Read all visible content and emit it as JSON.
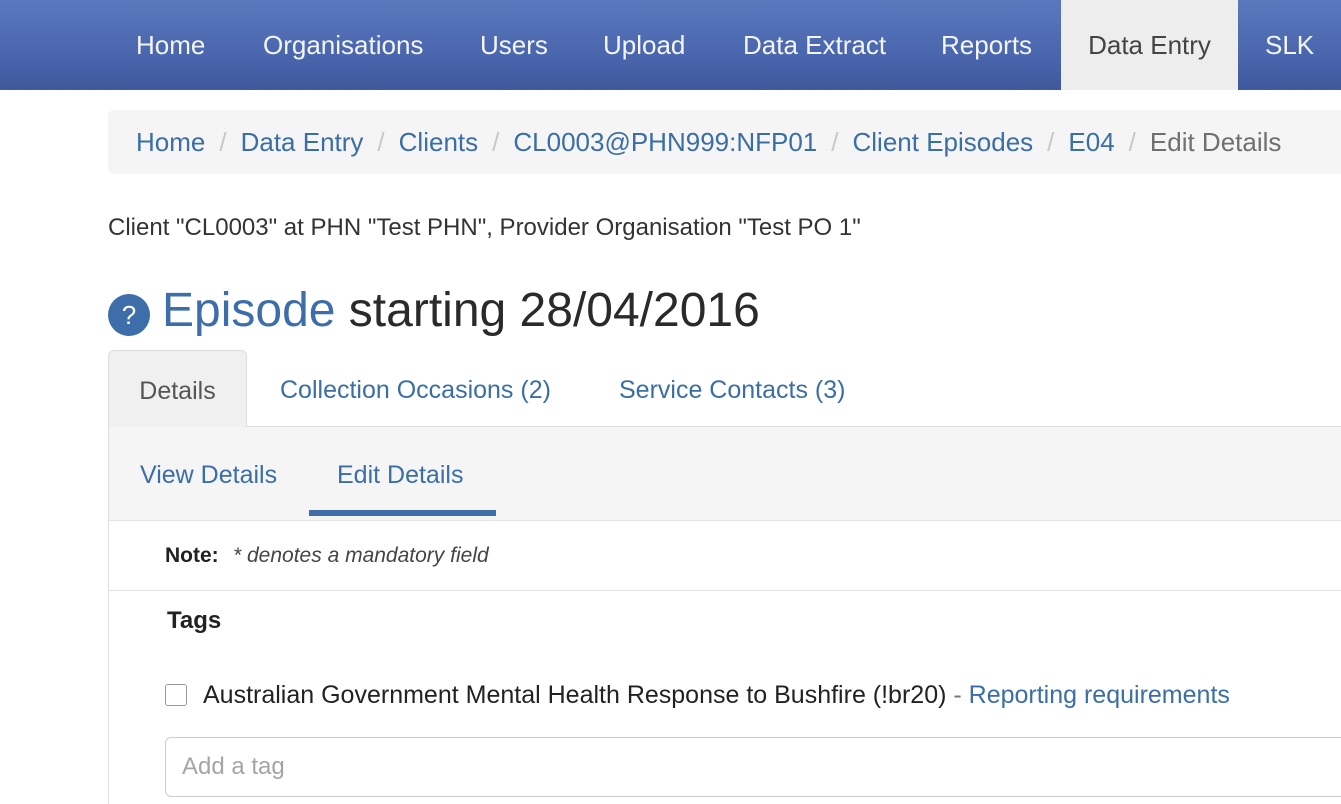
{
  "navbar": {
    "items": [
      {
        "label": "Home"
      },
      {
        "label": "Organisations"
      },
      {
        "label": "Users"
      },
      {
        "label": "Upload"
      },
      {
        "label": "Data Extract"
      },
      {
        "label": "Reports"
      },
      {
        "label": "Data Entry",
        "active": true
      },
      {
        "label": "SLK"
      }
    ]
  },
  "breadcrumb": {
    "separator": "/",
    "items": [
      {
        "label": "Home",
        "link": true
      },
      {
        "label": "Data Entry",
        "link": true
      },
      {
        "label": "Clients",
        "link": true
      },
      {
        "label": "CL0003@PHN999:NFP01",
        "link": true
      },
      {
        "label": "Client Episodes",
        "link": true
      },
      {
        "label": "E04",
        "link": true
      },
      {
        "label": "Edit Details",
        "link": false
      }
    ]
  },
  "client_info": "Client \"CL0003\" at PHN \"Test PHN\", Provider Organisation \"Test PO 1\"",
  "title": {
    "help_icon": "?",
    "link_text": "Episode",
    "rest": " starting 28/04/2016"
  },
  "tabs": [
    {
      "label": "Details",
      "active": true
    },
    {
      "label": "Collection Occasions (2)"
    },
    {
      "label": "Service Contacts (3)"
    }
  ],
  "subnav": [
    {
      "label": "View Details"
    },
    {
      "label": "Edit Details",
      "active": true
    }
  ],
  "note": {
    "label": "Note:",
    "text": "* denotes a mandatory field"
  },
  "tags": {
    "heading": "Tags",
    "checkbox_label": "Australian Government Mental Health Response to Bushfire (!br20)",
    "dash": " - ",
    "link_label": "Reporting requirements",
    "checked": false,
    "input_placeholder": "Add a tag",
    "input_value": ""
  },
  "colors": {
    "navbar": "#4a66ad",
    "link": "#3a6ea5",
    "active_tab_bg": "#ededed"
  }
}
